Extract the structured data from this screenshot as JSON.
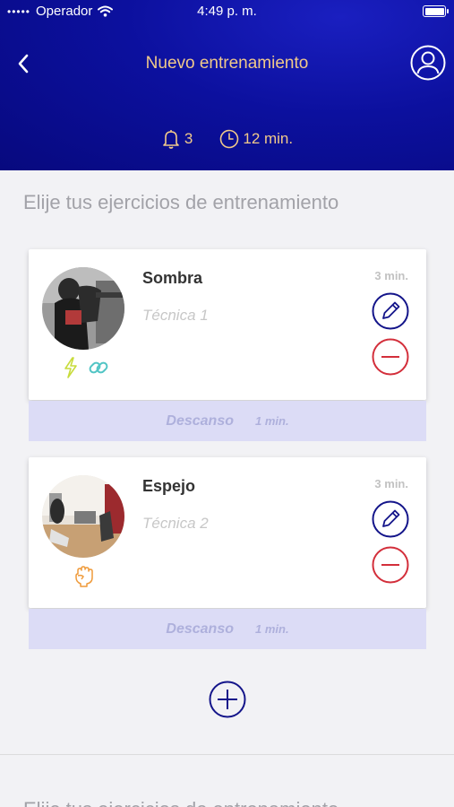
{
  "status_bar": {
    "carrier": "Operador",
    "time": "4:49 p. m.",
    "signal_dots": "•••••"
  },
  "header": {
    "title": "Nuevo entrenamiento",
    "alerts_count": "3",
    "total_duration": "12 min."
  },
  "subtitle": "Elije tus ejercicios de entrenamiento",
  "exercises": [
    {
      "name": "Sombra",
      "technique": "Técnica 1",
      "duration": "3 min.",
      "tags": [
        "lightning-icon",
        "link-icon"
      ],
      "rest": {
        "label": "Descanso",
        "duration": "1 min."
      }
    },
    {
      "name": "Espejo",
      "technique": "Técnica 2",
      "duration": "3 min.",
      "tags": [
        "fist-icon"
      ],
      "rest": {
        "label": "Descanso",
        "duration": "1 min."
      }
    }
  ],
  "footer_text": "Elije tus ejercicios de entrenamiento",
  "colors": {
    "header_bg": "#0c109e",
    "accent_gold": "#f0c98a",
    "edit_blue": "#14158a",
    "remove_red": "#d32f3b",
    "rest_bg": "#dcdcf6",
    "lightning": "#c8dc3c",
    "link": "#52c5c5",
    "fist": "#ef9a3a"
  }
}
